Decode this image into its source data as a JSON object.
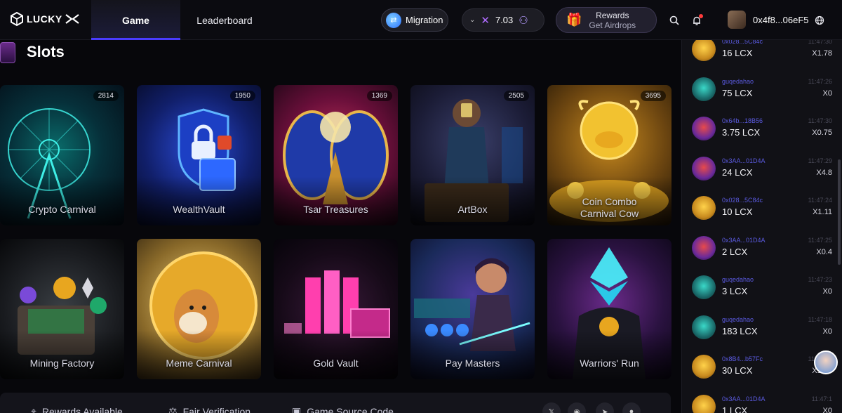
{
  "header": {
    "logo_text": "LUCKY",
    "tabs": [
      {
        "label": "Game",
        "active": true
      },
      {
        "label": "Leaderboard",
        "active": false
      }
    ],
    "migration_label": "Migration",
    "balance_value": "7.03",
    "rewards_title": "Rewards",
    "rewards_sub": "Get Airdrops",
    "wallet_address": "0x4f8...06eF5"
  },
  "main": {
    "section_title": "Slots",
    "games": [
      {
        "title": "Crypto Carnival",
        "count": "2814"
      },
      {
        "title": "WealthVault",
        "count": "1950"
      },
      {
        "title": "Tsar Treasures",
        "count": "1369"
      },
      {
        "title": "ArtBox",
        "count": "2505"
      },
      {
        "title": "Coin Combo Carnival Cow",
        "count": "3695"
      },
      {
        "title": "Mining Factory",
        "count": ""
      },
      {
        "title": "Meme Carnival",
        "count": ""
      },
      {
        "title": "Gold Vault",
        "count": ""
      },
      {
        "title": "Pay Masters",
        "count": ""
      },
      {
        "title": "Warriors' Run",
        "count": ""
      }
    ],
    "footer": {
      "rewards_available": "Rewards Available",
      "fair_verification": "Fair Verification",
      "game_source_code": "Game Source Code"
    }
  },
  "feed": [
    {
      "user": "0x028...5C84c",
      "amount": "16 LCX",
      "time": "11:47:30",
      "mult": "X1.78",
      "avatar": "cow"
    },
    {
      "user": "guqedahao",
      "amount": "75 LCX",
      "time": "11:47:26",
      "mult": "X0",
      "avatar": "monkey"
    },
    {
      "user": "0x64b...18B56",
      "amount": "3.75 LCX",
      "time": "11:47:30",
      "mult": "X0.75",
      "avatar": "warrior"
    },
    {
      "user": "0x3AA...01D4A",
      "amount": "24 LCX",
      "time": "11:47:29",
      "mult": "X4.8",
      "avatar": "warrior"
    },
    {
      "user": "0x028...5C84c",
      "amount": "10 LCX",
      "time": "11:47:24",
      "mult": "X1.11",
      "avatar": "cow"
    },
    {
      "user": "0x3AA...01D4A",
      "amount": "2 LCX",
      "time": "11:47:25",
      "mult": "X0.4",
      "avatar": "warrior"
    },
    {
      "user": "guqedahao",
      "amount": "3 LCX",
      "time": "11:47:23",
      "mult": "X0",
      "avatar": "monkey"
    },
    {
      "user": "guqedahao",
      "amount": "183 LCX",
      "time": "11:47:18",
      "mult": "X0",
      "avatar": "monkey"
    },
    {
      "user": "0x8B4...b57Fc",
      "amount": "30 LCX",
      "time": "11:47:18",
      "mult": "X1.67",
      "avatar": "cow"
    },
    {
      "user": "0x3AA...01D4A",
      "amount": "1 LCX",
      "time": "11:47:1",
      "mult": "X0",
      "avatar": "cow"
    }
  ],
  "colors": {
    "accent": "#4a3cff",
    "feed_user": "#5a5adf",
    "notification": "#ff3b3b"
  }
}
